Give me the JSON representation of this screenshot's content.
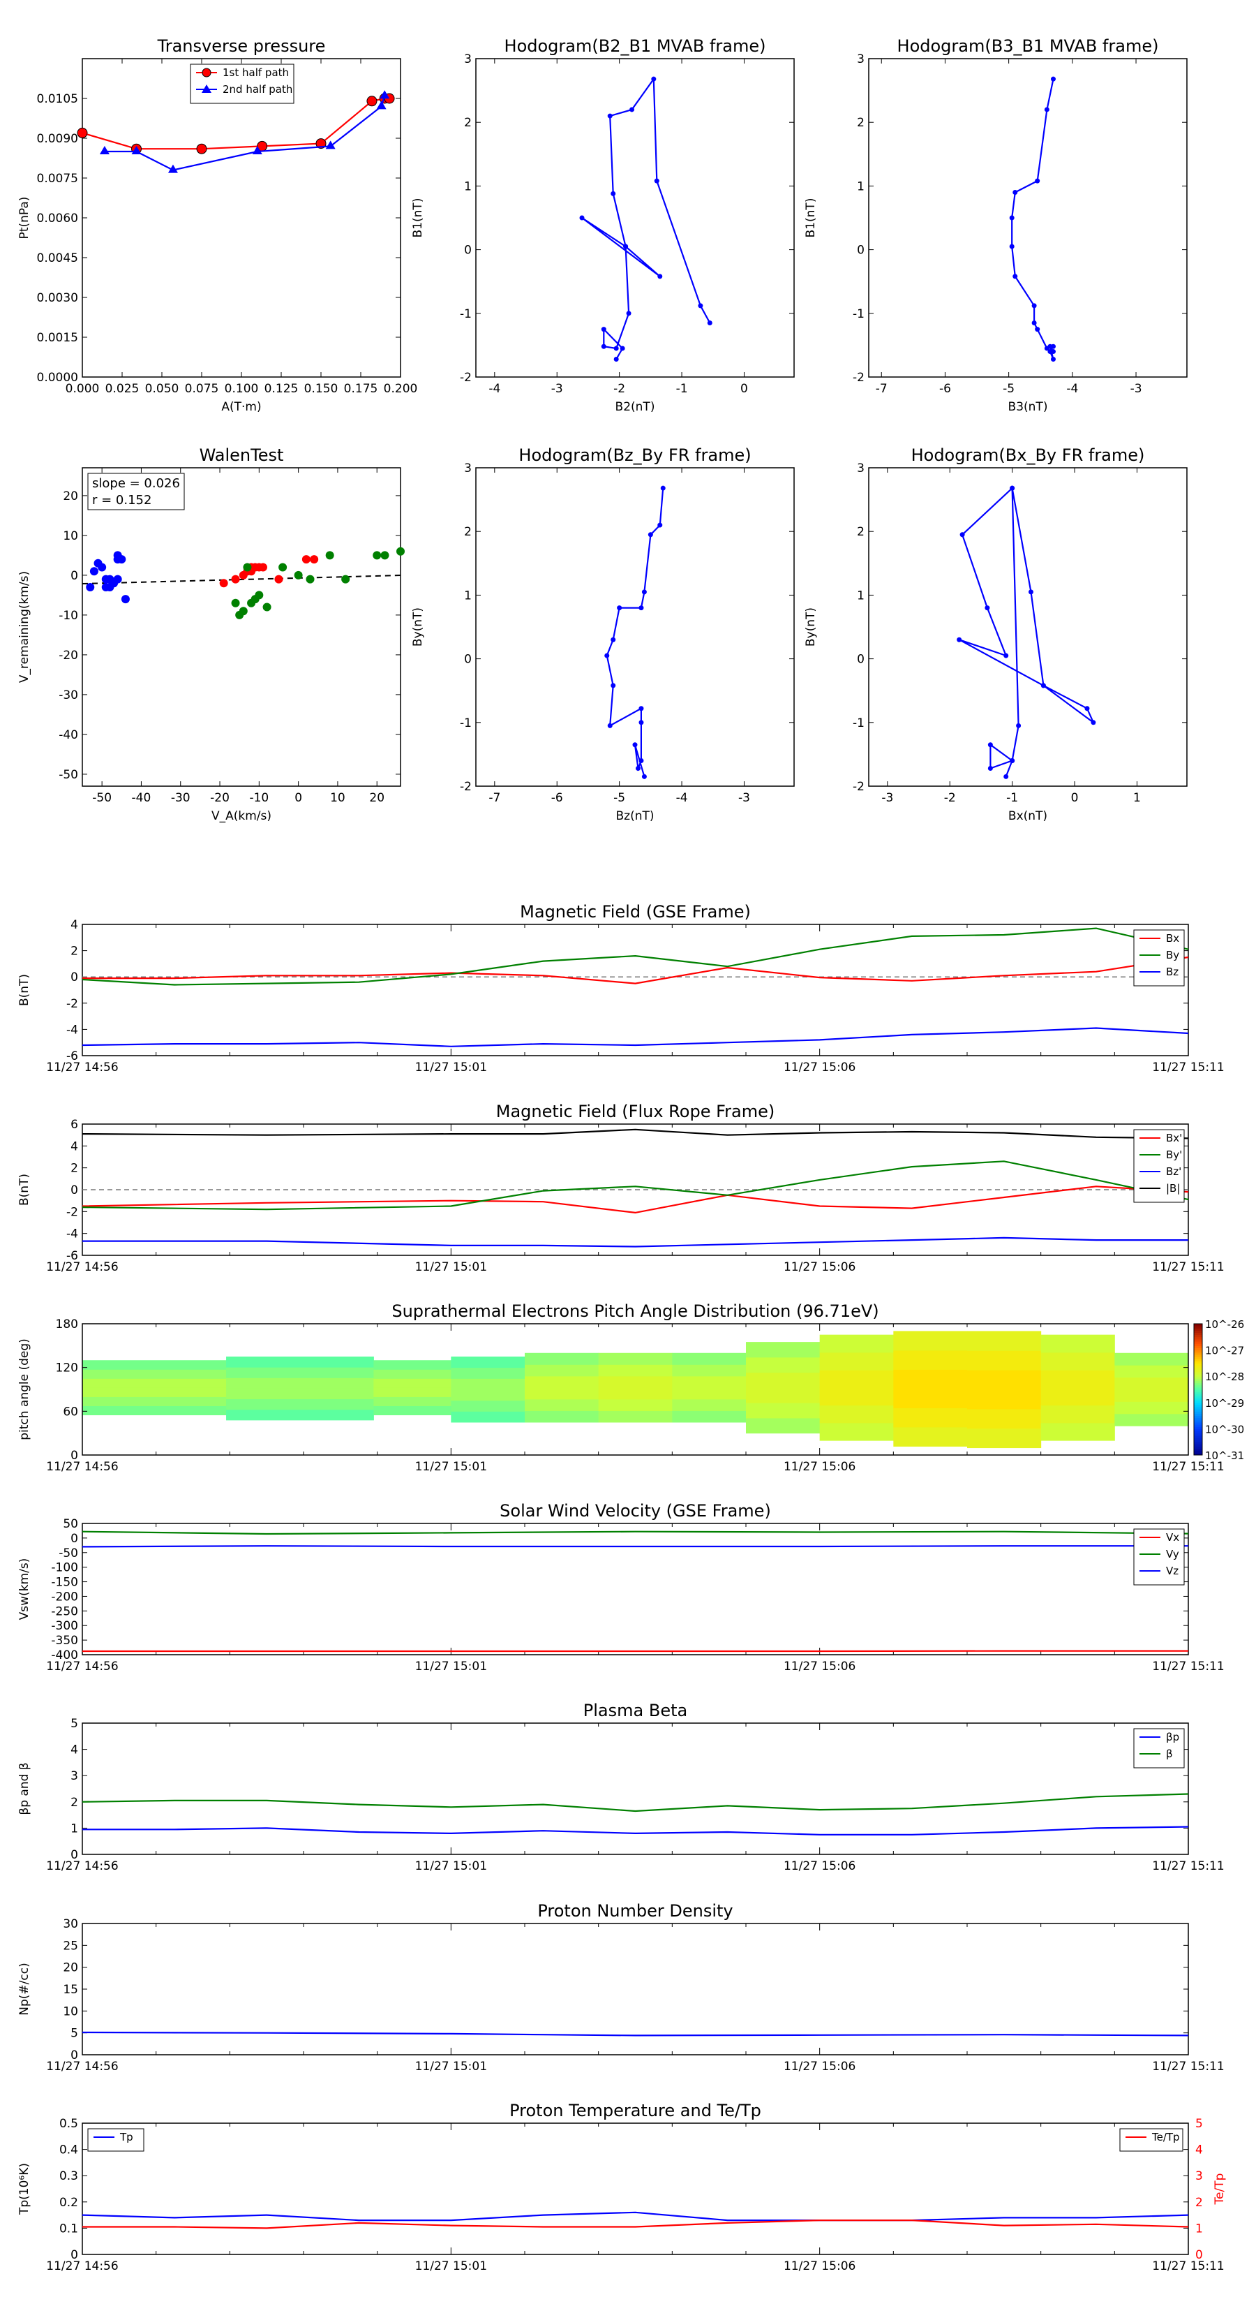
{
  "time_ticks": [
    "11/27 14:56",
    "11/27 15:01",
    "11/27 15:06",
    "11/27 15:11"
  ],
  "chart_data": [
    {
      "id": "pt",
      "type": "line",
      "title": "Transverse pressure",
      "xlabel": "A(T·m)",
      "ylabel": "Pt(nPa)",
      "xlim": [
        0,
        0.2
      ],
      "ylim": [
        0,
        0.012
      ],
      "xticks": [
        0,
        0.025,
        0.05,
        0.075,
        0.1,
        0.125,
        0.15,
        0.175,
        0.2
      ],
      "xtick_labels": [
        "0.000",
        "0.025",
        "0.050",
        "0.075",
        "0.100",
        "0.125",
        "0.150",
        "0.175",
        "0.200"
      ],
      "yticks": [
        0,
        0.0015,
        0.003,
        0.0045,
        0.006,
        0.0075,
        0.009,
        0.0105
      ],
      "ytick_labels": [
        "0.0000",
        "0.0015",
        "0.0030",
        "0.0045",
        "0.0060",
        "0.0075",
        "0.0090",
        "0.0105"
      ],
      "legend": "top-center",
      "series": [
        {
          "name": "1st half path",
          "color": "#ff0000",
          "marker": "circle",
          "x": [
            0.0,
            0.034,
            0.075,
            0.113,
            0.15,
            0.182,
            0.19,
            0.193
          ],
          "y": [
            0.0092,
            0.0086,
            0.0086,
            0.0087,
            0.0088,
            0.0104,
            0.0105,
            0.0105
          ]
        },
        {
          "name": "2nd half path",
          "color": "#0000ff",
          "marker": "triangle",
          "x": [
            0.014,
            0.034,
            0.057,
            0.11,
            0.156,
            0.188,
            0.19
          ],
          "y": [
            0.0085,
            0.0085,
            0.0078,
            0.0085,
            0.0087,
            0.0102,
            0.0106
          ]
        }
      ]
    },
    {
      "id": "h1",
      "type": "line",
      "title": "Hodogram(B2_B1 MVAB frame)",
      "xlabel": "B2(nT)",
      "ylabel": "B1(nT)",
      "xlim": [
        -4.3,
        0.8
      ],
      "ylim": [
        -2,
        3
      ],
      "xticks": [
        -4,
        -3,
        -2,
        -1,
        0
      ],
      "yticks": [
        -2,
        -1,
        0,
        1,
        2,
        3
      ],
      "series": [
        {
          "color": "#0000ff",
          "marker": "dot",
          "x": [
            -0.55,
            -0.7,
            -1.4,
            -1.45,
            -1.8,
            -2.15,
            -2.1,
            -1.9,
            -2.6,
            -1.35,
            -1.9,
            -1.85,
            -2.05,
            -2.25,
            -2.25,
            -1.95,
            -2.05
          ],
          "y": [
            -1.15,
            -0.88,
            1.08,
            2.68,
            2.2,
            2.1,
            0.88,
            0.05,
            0.5,
            -0.42,
            0.05,
            -1.0,
            -1.55,
            -1.52,
            -1.25,
            -1.55,
            -1.72
          ]
        }
      ]
    },
    {
      "id": "h2",
      "type": "line",
      "title": "Hodogram(B3_B1 MVAB frame)",
      "xlabel": "B3(nT)",
      "ylabel": "B1(nT)",
      "xlim": [
        -7.2,
        -2.2
      ],
      "ylim": [
        -2,
        3
      ],
      "xticks": [
        -7,
        -6,
        -5,
        -4,
        -3
      ],
      "yticks": [
        -2,
        -1,
        0,
        1,
        2,
        3
      ],
      "series": [
        {
          "color": "#0000ff",
          "marker": "dot",
          "x": [
            -4.3,
            -4.4,
            -4.55,
            -4.9,
            -4.95,
            -4.95,
            -4.9,
            -4.6,
            -4.6,
            -4.55,
            -4.4,
            -4.3,
            -4.35,
            -4.3,
            -4.35,
            -4.3
          ],
          "y": [
            2.68,
            2.2,
            1.08,
            0.9,
            0.5,
            0.05,
            -0.42,
            -0.88,
            -1.15,
            -1.25,
            -1.55,
            -1.52,
            -1.6,
            -1.72,
            -1.52,
            -1.6
          ]
        }
      ]
    },
    {
      "id": "walen",
      "type": "scatter",
      "title": "WalenTest",
      "xlabel": "V_A(km/s)",
      "ylabel": "V_remaining(km/s)",
      "xlim": [
        -55,
        26
      ],
      "ylim": [
        -53,
        27
      ],
      "xticks": [
        -50,
        -40,
        -30,
        -20,
        -10,
        0,
        10,
        20
      ],
      "yticks": [
        -50,
        -40,
        -30,
        -20,
        -10,
        0,
        10,
        20
      ],
      "annotation": [
        "slope = 0.026",
        "r = 0.152"
      ],
      "fit": {
        "slope": 0.026,
        "intercept": -0.7,
        "color": "#000000"
      },
      "series": [
        {
          "color": "#0000ff",
          "x": [
            -52,
            -51,
            -50,
            -49,
            -48,
            -47,
            -46,
            -45,
            -47,
            -48,
            -46,
            -44,
            -53,
            -46,
            -49
          ],
          "y": [
            1,
            3,
            2,
            -1,
            -1,
            -2,
            4,
            4,
            -2,
            -3,
            -1,
            -6,
            -3,
            5,
            -3
          ]
        },
        {
          "color": "#ff0000",
          "x": [
            -19,
            -16,
            -13,
            -12,
            -11,
            -10,
            -9,
            2,
            4,
            -5,
            -14,
            -12
          ],
          "y": [
            -2,
            -1,
            1,
            2,
            2,
            2,
            2,
            4,
            4,
            -1,
            0,
            1
          ]
        },
        {
          "color": "#008000",
          "x": [
            -16,
            -14,
            -12,
            -10,
            -8,
            -15,
            -13,
            -11,
            -4,
            0,
            3,
            8,
            12,
            20,
            22,
            26
          ],
          "y": [
            -7,
            -9,
            -7,
            -5,
            -8,
            -10,
            2,
            -6,
            2,
            0,
            -1,
            5,
            -1,
            5,
            5,
            6
          ]
        }
      ]
    },
    {
      "id": "h3",
      "type": "line",
      "title": "Hodogram(Bz_By FR frame)",
      "xlabel": "Bz(nT)",
      "ylabel": "By(nT)",
      "xlim": [
        -7.3,
        -2.2
      ],
      "ylim": [
        -2,
        3
      ],
      "xticks": [
        -7,
        -6,
        -5,
        -4,
        -3
      ],
      "yticks": [
        -2,
        -1,
        0,
        1,
        2,
        3
      ],
      "series": [
        {
          "color": "#0000ff",
          "marker": "dot",
          "x": [
            -4.3,
            -4.35,
            -4.5,
            -4.6,
            -4.65,
            -5.0,
            -5.1,
            -5.2,
            -5.1,
            -5.15,
            -4.65,
            -4.65,
            -4.65,
            -4.7,
            -4.75,
            -4.6
          ],
          "y": [
            2.68,
            2.1,
            1.95,
            1.05,
            0.8,
            0.8,
            0.3,
            0.05,
            -0.42,
            -1.05,
            -0.78,
            -1.0,
            -1.6,
            -1.72,
            -1.35,
            -1.85
          ]
        }
      ]
    },
    {
      "id": "h4",
      "type": "line",
      "title": "Hodogram(Bx_By FR frame)",
      "xlabel": "Bx(nT)",
      "ylabel": "By(nT)",
      "xlim": [
        -3.3,
        1.8
      ],
      "ylim": [
        -2,
        3
      ],
      "xticks": [
        -3,
        -2,
        -1,
        0,
        1
      ],
      "yticks": [
        -2,
        -1,
        0,
        1,
        2,
        3
      ],
      "series": [
        {
          "color": "#0000ff",
          "marker": "dot",
          "x": [
            -1.0,
            -0.7,
            -0.5,
            0.2,
            0.3,
            -0.5,
            -1.85,
            -1.1,
            -1.4,
            -1.8,
            -1.0,
            -0.9,
            -1.0,
            -1.35,
            -1.35,
            -1.0,
            -1.1
          ],
          "y": [
            2.68,
            1.05,
            -0.42,
            -0.78,
            -1.0,
            -0.42,
            0.3,
            0.05,
            0.8,
            1.95,
            2.68,
            -1.05,
            -1.6,
            -1.35,
            -1.72,
            -1.6,
            -1.85
          ]
        }
      ]
    },
    {
      "id": "bgse",
      "type": "line",
      "title": "Magnetic Field (GSE Frame)",
      "ylabel": "B(nT)",
      "ylim": [
        -6,
        4
      ],
      "yticks": [
        -6,
        -4,
        -2,
        0,
        2,
        4
      ],
      "legend": "top-right",
      "zero_line": true,
      "x_minutes": [
        0,
        1.25,
        2.5,
        3.75,
        5,
        6.25,
        7.5,
        8.75,
        10,
        11.25,
        12.5,
        13.75,
        15
      ],
      "series": [
        {
          "name": "Bx",
          "color": "#ff0000",
          "values": [
            -0.1,
            -0.1,
            0.1,
            0.1,
            0.3,
            0.1,
            -0.5,
            0.7,
            -0.05,
            -0.3,
            0.1,
            0.4,
            1.5
          ]
        },
        {
          "name": "By",
          "color": "#008000",
          "values": [
            -0.2,
            -0.6,
            -0.5,
            -0.4,
            0.2,
            1.2,
            1.6,
            0.8,
            2.1,
            3.1,
            3.2,
            3.7,
            2.1
          ]
        },
        {
          "name": "Bz",
          "color": "#0000ff",
          "values": [
            -5.2,
            -5.1,
            -5.1,
            -5.0,
            -5.3,
            -5.1,
            -5.2,
            -5.0,
            -4.8,
            -4.4,
            -4.2,
            -3.9,
            -4.3
          ]
        }
      ],
      "tail": {
        "By_end": [
          -0.1,
          0.1
        ],
        "Bx_end": [
          0.8,
          1.5
        ],
        "Bz_end": [
          -4.5,
          -4.4
        ]
      }
    },
    {
      "id": "bfr",
      "type": "line",
      "title": "Magnetic Field (Flux Rope Frame)",
      "ylabel": "B(nT)",
      "ylim": [
        -6,
        6
      ],
      "yticks": [
        -6,
        -4,
        -2,
        0,
        2,
        4,
        6
      ],
      "legend": "top-right",
      "zero_line": true,
      "x_minutes": [
        0,
        2.5,
        5,
        6.25,
        7.5,
        8.75,
        10,
        11.25,
        12.5,
        13.75,
        15
      ],
      "series": [
        {
          "name": "Bx'",
          "color": "#ff0000",
          "values": [
            -1.5,
            -1.2,
            -1.0,
            -1.1,
            -2.1,
            -0.5,
            -1.5,
            -1.7,
            -0.7,
            0.3,
            -0.2
          ]
        },
        {
          "name": "By'",
          "color": "#008000",
          "values": [
            -1.6,
            -1.8,
            -1.5,
            -0.1,
            0.3,
            -0.5,
            0.9,
            2.1,
            2.6,
            0.9,
            -0.9
          ]
        },
        {
          "name": "Bz'",
          "color": "#0000ff",
          "values": [
            -4.7,
            -4.7,
            -5.1,
            -5.1,
            -5.2,
            -5.0,
            -4.8,
            -4.6,
            -4.4,
            -4.6,
            -4.6
          ]
        },
        {
          "name": "|B|",
          "color": "#000000",
          "values": [
            5.1,
            5.0,
            5.1,
            5.1,
            5.5,
            5.0,
            5.2,
            5.3,
            5.2,
            4.8,
            4.7
          ]
        }
      ]
    },
    {
      "id": "pad",
      "type": "heatmap",
      "title": "Suprathermal Electrons Pitch Angle Distribution (96.71eV)",
      "ylabel": "pitch angle (deg)",
      "ylim": [
        0,
        180
      ],
      "yticks": [
        0,
        60,
        120,
        180
      ],
      "colorbar": {
        "min_exp": -31,
        "max_exp": -26,
        "tick_labels": [
          "10^-31",
          "10^-30",
          "10^-29",
          "10^-28",
          "10^-27",
          "10^-26"
        ]
      },
      "columns": [
        {
          "t0": 0,
          "t1": 1.95,
          "low": 55,
          "high": 130,
          "value": -28.0
        },
        {
          "t0": 1.95,
          "t1": 3.95,
          "low": 48,
          "high": 135,
          "value": -28.1
        },
        {
          "t0": 3.95,
          "t1": 5.0,
          "low": 55,
          "high": 130,
          "value": -28.0
        },
        {
          "t0": 5.0,
          "t1": 6.0,
          "low": 45,
          "high": 135,
          "value": -28.1
        },
        {
          "t0": 6.0,
          "t1": 7.0,
          "low": 45,
          "high": 140,
          "value": -27.9
        },
        {
          "t0": 7.0,
          "t1": 8.0,
          "low": 45,
          "high": 140,
          "value": -27.8
        },
        {
          "t0": 8.0,
          "t1": 9.0,
          "low": 45,
          "high": 140,
          "value": -27.9
        },
        {
          "t0": 9.0,
          "t1": 10.0,
          "low": 30,
          "high": 155,
          "value": -27.8
        },
        {
          "t0": 10.0,
          "t1": 11.0,
          "low": 20,
          "high": 165,
          "value": -27.6
        },
        {
          "t0": 11.0,
          "t1": 12.0,
          "low": 12,
          "high": 170,
          "value": -27.4
        },
        {
          "t0": 12.0,
          "t1": 13.0,
          "low": 10,
          "high": 170,
          "value": -27.4
        },
        {
          "t0": 13.0,
          "t1": 14.0,
          "low": 20,
          "high": 165,
          "value": -27.6
        },
        {
          "t0": 14.0,
          "t1": 15.0,
          "low": 40,
          "high": 140,
          "value": -27.8
        }
      ]
    },
    {
      "id": "vsw",
      "type": "line",
      "title": "Solar Wind Velocity (GSE Frame)",
      "ylabel": "Vsw(km/s)",
      "ylim": [
        -400,
        50
      ],
      "yticks": [
        -400,
        -350,
        -300,
        -250,
        -200,
        -150,
        -100,
        -50,
        0,
        50
      ],
      "legend": "top-right",
      "x_minutes": [
        0,
        2.5,
        5,
        7.5,
        10,
        12.5,
        15
      ],
      "series": [
        {
          "name": "Vx",
          "color": "#ff0000",
          "values": [
            -388,
            -388,
            -388,
            -388,
            -388,
            -387,
            -387
          ]
        },
        {
          "name": "Vy",
          "color": "#008000",
          "values": [
            22,
            14,
            18,
            22,
            20,
            22,
            15
          ]
        },
        {
          "name": "Vz",
          "color": "#0000ff",
          "values": [
            -30,
            -27,
            -29,
            -29,
            -29,
            -27,
            -27
          ]
        }
      ]
    },
    {
      "id": "beta",
      "type": "line",
      "title": "Plasma Beta",
      "ylabel": "βp and β",
      "ylim": [
        0,
        5
      ],
      "yticks": [
        0,
        1,
        2,
        3,
        4,
        5
      ],
      "legend": "top-right",
      "x_minutes": [
        0,
        1.25,
        2.5,
        3.75,
        5,
        6.25,
        7.5,
        8.75,
        10,
        11.25,
        12.5,
        13.75,
        15
      ],
      "series": [
        {
          "name": "βp",
          "color": "#0000ff",
          "values": [
            0.95,
            0.95,
            1.0,
            0.85,
            0.8,
            0.9,
            0.8,
            0.85,
            0.75,
            0.75,
            0.85,
            1.0,
            1.05
          ]
        },
        {
          "name": "β",
          "color": "#008000",
          "values": [
            2.0,
            2.05,
            2.05,
            1.9,
            1.8,
            1.9,
            1.65,
            1.85,
            1.7,
            1.75,
            1.95,
            2.2,
            2.3
          ]
        }
      ]
    },
    {
      "id": "np",
      "type": "line",
      "title": "Proton Number Density",
      "ylabel": "Np(#/cc)",
      "ylim": [
        0,
        30
      ],
      "yticks": [
        0,
        5,
        10,
        15,
        20,
        25,
        30
      ],
      "x_minutes": [
        0,
        2.5,
        5,
        6.25,
        7.5,
        10,
        12.5,
        15
      ],
      "series": [
        {
          "name": "Np",
          "color": "#0000ff",
          "values": [
            5.1,
            5.0,
            4.8,
            4.6,
            4.4,
            4.5,
            4.6,
            4.4
          ]
        }
      ]
    },
    {
      "id": "tp",
      "type": "line",
      "title": "Proton Temperature and Te/Tp",
      "ylabel": "Tp(10⁶K)",
      "ylabel_right": "Te/Tp",
      "ylim": [
        0,
        0.5
      ],
      "ylim_right": [
        0,
        5
      ],
      "yticks": [
        0,
        0.1,
        0.2,
        0.3,
        0.4,
        0.5
      ],
      "yticks_right": [
        0,
        1,
        2,
        3,
        4,
        5
      ],
      "legend": "top-left",
      "legend_right": "top-right",
      "x_minutes": [
        0,
        1.25,
        2.5,
        3.75,
        5,
        6.25,
        7.5,
        8.75,
        10,
        11.25,
        12.5,
        13.75,
        15
      ],
      "series": [
        {
          "name": "Tp",
          "color": "#0000ff",
          "axis": "left",
          "values": [
            0.15,
            0.14,
            0.15,
            0.13,
            0.13,
            0.15,
            0.16,
            0.13,
            0.13,
            0.13,
            0.14,
            0.14,
            0.15
          ]
        },
        {
          "name": "Te/Tp",
          "color": "#ff0000",
          "axis": "right",
          "values": [
            1.05,
            1.05,
            1.0,
            1.2,
            1.1,
            1.05,
            1.05,
            1.2,
            1.3,
            1.3,
            1.1,
            1.15,
            1.05
          ]
        }
      ]
    }
  ]
}
